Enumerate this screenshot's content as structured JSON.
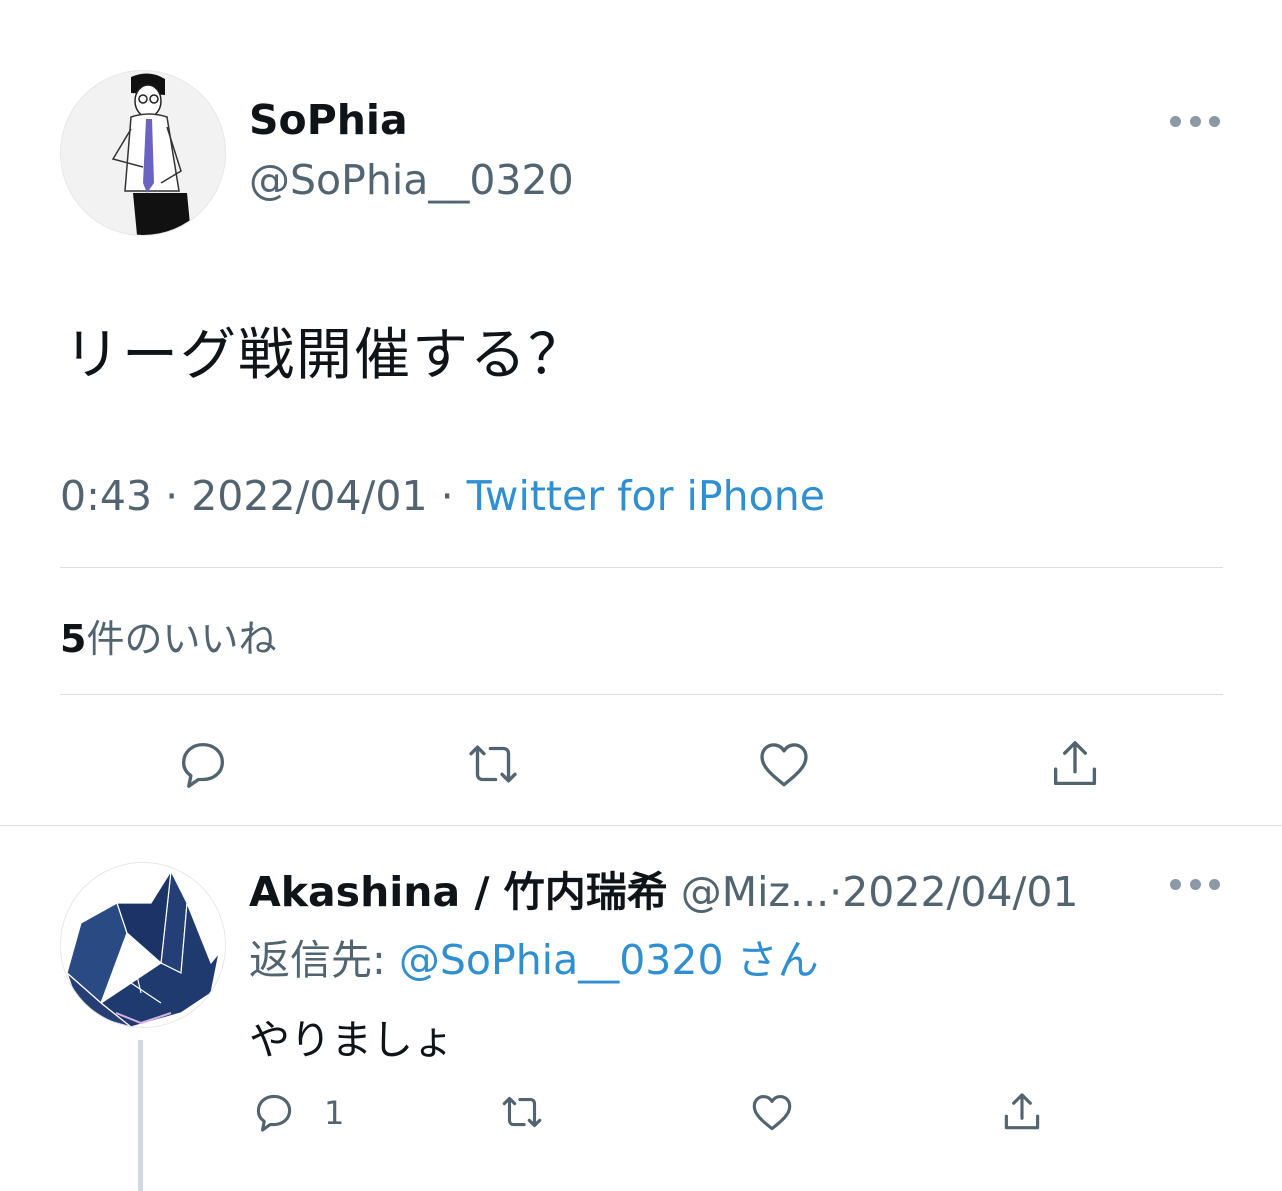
{
  "tweet": {
    "author": {
      "display_name": "SoPhia",
      "handle": "@SoPhia__0320",
      "avatar_icon": "person-illustration-avatar"
    },
    "text": "リーグ戦開催する？",
    "time": "0:43",
    "separator": "·",
    "date": "2022/04/01",
    "source": "Twitter for iPhone",
    "likes": {
      "count": "5",
      "label": "件のいいね"
    },
    "more_icon": "more-horizontal-icon",
    "actions": [
      {
        "name": "reply",
        "icon": "reply-icon"
      },
      {
        "name": "retweet",
        "icon": "retweet-icon"
      },
      {
        "name": "like",
        "icon": "heart-icon"
      },
      {
        "name": "share",
        "icon": "share-icon"
      }
    ]
  },
  "reply": {
    "author": {
      "display_name": "Akashina / 竹内瑞希",
      "handle": "@Miz...",
      "avatar_icon": "origami-crane-avatar"
    },
    "separator": "·",
    "date": "2022/04/01",
    "reply_to_label": "返信先: ",
    "reply_to_mention": "@SoPhia__0320",
    "reply_to_suffix": "さん",
    "text": "やりましょ",
    "reply_count": "1",
    "more_icon": "more-horizontal-icon"
  },
  "colors": {
    "text_primary": "#0f1419",
    "text_secondary": "#536471",
    "link": "#2f8fd0",
    "divider": "#dadfe3"
  }
}
